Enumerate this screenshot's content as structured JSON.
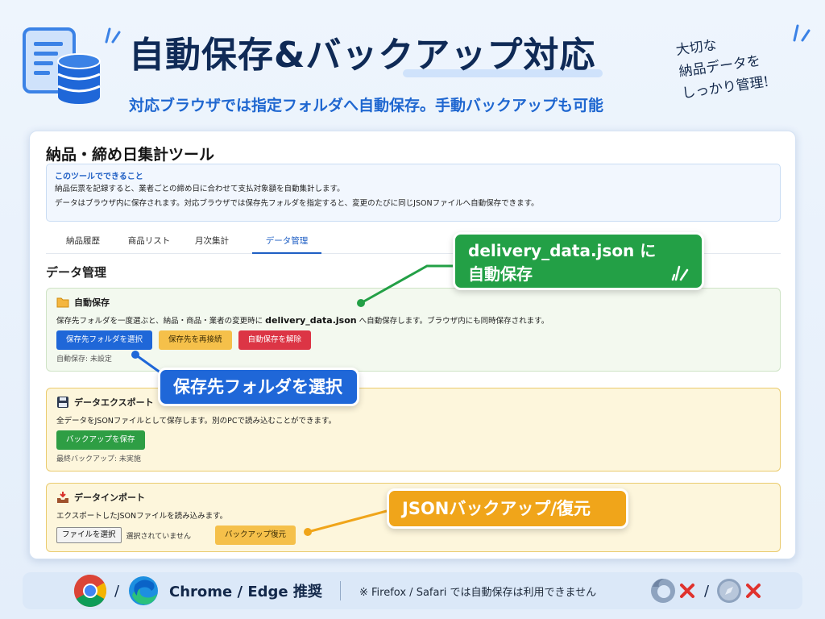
{
  "header": {
    "title": "自動保存&バックアップ対応",
    "subtitle": "対応ブラウザでは指定フォルダへ自動保存。手動バックアップも可能",
    "handnote": "大切な\n納品データを\nしっかり管理!"
  },
  "app": {
    "title": "納品・締め日集計ツール",
    "info": {
      "title": "このツールでできること",
      "line1": "納品伝票を記録すると、業者ごとの締め日に合わせて支払対象額を自動集計します。",
      "line2": "データはブラウザ内に保存されます。対応ブラウザでは保存先フォルダを指定すると、変更のたびに同じJSONファイルへ自動保存できます。"
    },
    "tabs": [
      {
        "label": "納品履歴",
        "active": false
      },
      {
        "label": "商品リスト",
        "active": false
      },
      {
        "label": "月次集計",
        "active": false
      },
      {
        "label": "データ管理",
        "active": true
      }
    ],
    "section_heading": "データ管理",
    "autosave": {
      "title": "自動保存",
      "desc_before": "保存先フォルダを一度選ぶと、納品・商品・業者の変更時に ",
      "desc_file": "delivery_data.json",
      "desc_after": " へ自動保存します。ブラウザ内にも同時保存されます。",
      "btn_select": "保存先フォルダを選択",
      "btn_reconnect": "保存先を再接続",
      "btn_disable": "自動保存を解除",
      "status": "自動保存: 未設定"
    },
    "export": {
      "title": "データエクスポート",
      "desc": "全データをJSONファイルとして保存します。別のPCで読み込むことができます。",
      "btn_save": "バックアップを保存",
      "status": "最終バックアップ: 未実施"
    },
    "import": {
      "title": "データインポート",
      "desc": "エクスポートしたJSONファイルを読み込みます。",
      "btn_file": "ファイルを選択",
      "file_status": "選択されていません",
      "btn_restore": "バックアップ復元"
    }
  },
  "callouts": {
    "green_line1": "delivery_data.json に",
    "green_line2": "自動保存",
    "blue": "保存先フォルダを選択",
    "orange": "JSONバックアップ/復元"
  },
  "footer": {
    "slash": "/",
    "browsers": "Chrome / Edge 推奨",
    "note": "※ Firefox / Safari では自動保存は利用できません"
  },
  "colors": {
    "primary_blue": "#1f67d8",
    "accent_green": "#23a046",
    "accent_orange": "#f0a51a",
    "danger_red": "#dc3545"
  }
}
